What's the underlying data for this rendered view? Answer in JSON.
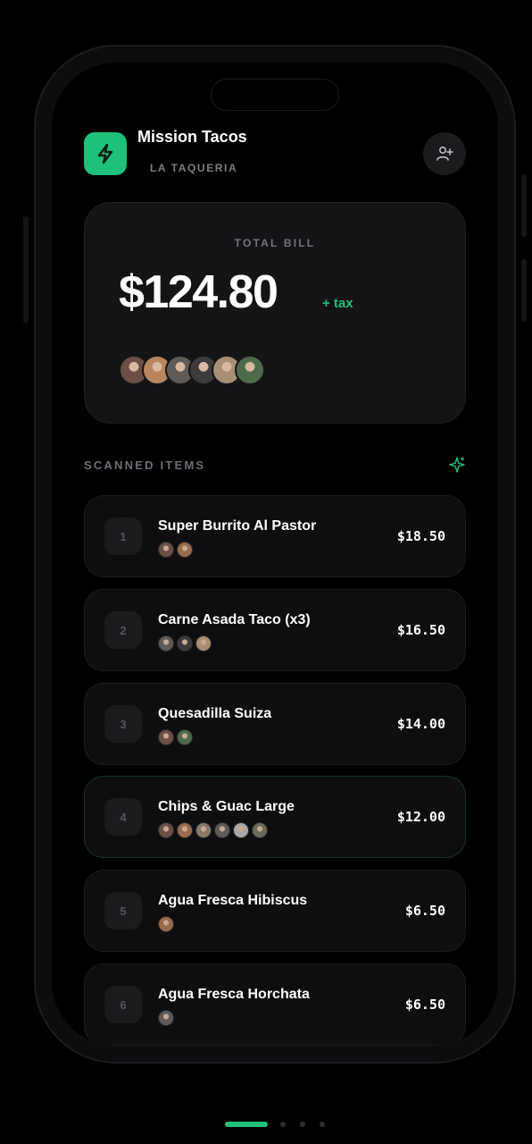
{
  "header": {
    "title": "Mission Tacos",
    "subtitle": "LA TAQUERIA",
    "app_icon": "lightning-icon",
    "add_user_icon": "user-plus-icon"
  },
  "bill": {
    "label": "TOTAL BILL",
    "amount": "$124.80",
    "tax": "+ tax",
    "participants": [
      "#6b4f47",
      "#b9855e",
      "#5e5a57",
      "#3b3b3d",
      "#a88e73",
      "#4d6b4b"
    ]
  },
  "items_section": {
    "label": "SCANNED ITEMS",
    "icon": "sparkle-icon"
  },
  "items": [
    {
      "num": "1",
      "name": "Super Burrito Al Pastor",
      "price": "$18.50",
      "people": [
        "#6b4f47",
        "#9a6a4a"
      ]
    },
    {
      "num": "2",
      "name": "Carne Asada Taco (x3)",
      "price": "$16.50",
      "people": [
        "#5e5a57",
        "#3b3b3d",
        "#a88e73"
      ]
    },
    {
      "num": "3",
      "name": "Quesadilla Suiza",
      "price": "$14.00",
      "people": [
        "#6b4f47",
        "#4d6b4b"
      ]
    },
    {
      "num": "4",
      "name": "Chips & Guac Large",
      "price": "$12.00",
      "people": [
        "#6b4f47",
        "#9a6a4a",
        "#8a7a6a",
        "#5e5a57",
        "#a8a8a8",
        "#6b6b5a"
      ]
    },
    {
      "num": "5",
      "name": "Agua Fresca Hibiscus",
      "price": "$6.50",
      "people": [
        "#9a6a4a"
      ]
    },
    {
      "num": "6",
      "name": "Agua Fresca Horchata",
      "price": "$6.50",
      "people": [
        "#5e5a57"
      ]
    }
  ],
  "colors": {
    "accent": "#1ec17a",
    "background": "#000000",
    "card": "#141416"
  }
}
